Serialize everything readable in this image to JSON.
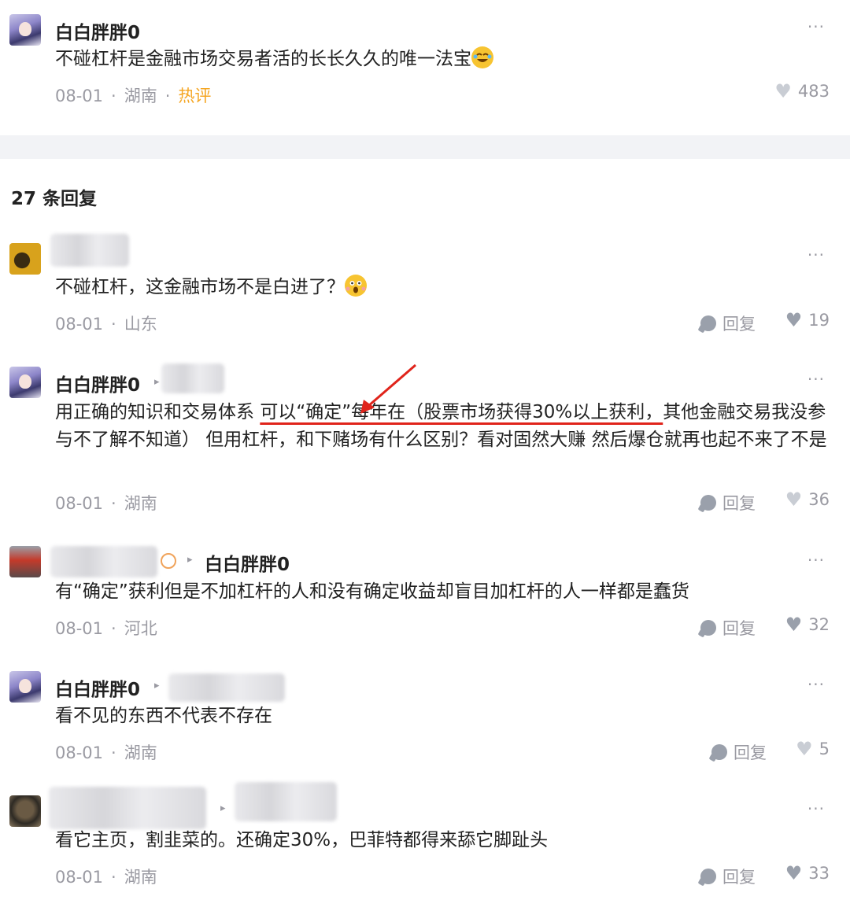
{
  "top_comment": {
    "username": "白白胖胖0",
    "text": "不碰杠杆是金融市场交易者活的长长久久的唯一法宝",
    "emoji": "rofl-emoji",
    "date": "08-01",
    "location": "湖南",
    "tag": "热评",
    "likes": "483",
    "more": "···"
  },
  "replies_header": "27 条回复",
  "replies": [
    {
      "text": "不碰杠杆，这金融市场不是白进了？",
      "emoji": "shocked-emoji",
      "date": "08-01",
      "location": "山东",
      "reply_label": "回复",
      "likes": "19",
      "more": "···"
    },
    {
      "username": "白白胖胖0",
      "text_before": "用正确的知识和交易体系 ",
      "text_highlight": "可以“确定”每年在（股票市场获得30%以上获利，",
      "text_after": "其他金融交易我没参与不了解不知道） 但用杠杆，和下赌场有什么区别？看对固然大赚 然后爆仓就再也起不来了不是",
      "date": "08-01",
      "location": "湖南",
      "reply_label": "回复",
      "likes": "36",
      "more": "···"
    },
    {
      "reply_to": "白白胖胖0",
      "text": "有“确定”获利但是不加杠杆的人和没有确定收益却盲目加杠杆的人一样都是蠢货",
      "date": "08-01",
      "location": "河北",
      "reply_label": "回复",
      "likes": "32",
      "more": "···"
    },
    {
      "username": "白白胖胖0",
      "text": "看不见的东西不代表不存在",
      "date": "08-01",
      "location": "湖南",
      "reply_label": "回复",
      "likes": "5",
      "more": "···"
    },
    {
      "text": "看它主页，割韭菜的。还确定30%，巴菲特都得来舔它脚趾头",
      "date": "08-01",
      "location": "湖南",
      "reply_label": "回复",
      "likes": "33",
      "more": "···"
    }
  ],
  "colors": {
    "hot_tag": "#f5a623",
    "annotation": "#e0241b",
    "meta": "#9a9aa2"
  }
}
